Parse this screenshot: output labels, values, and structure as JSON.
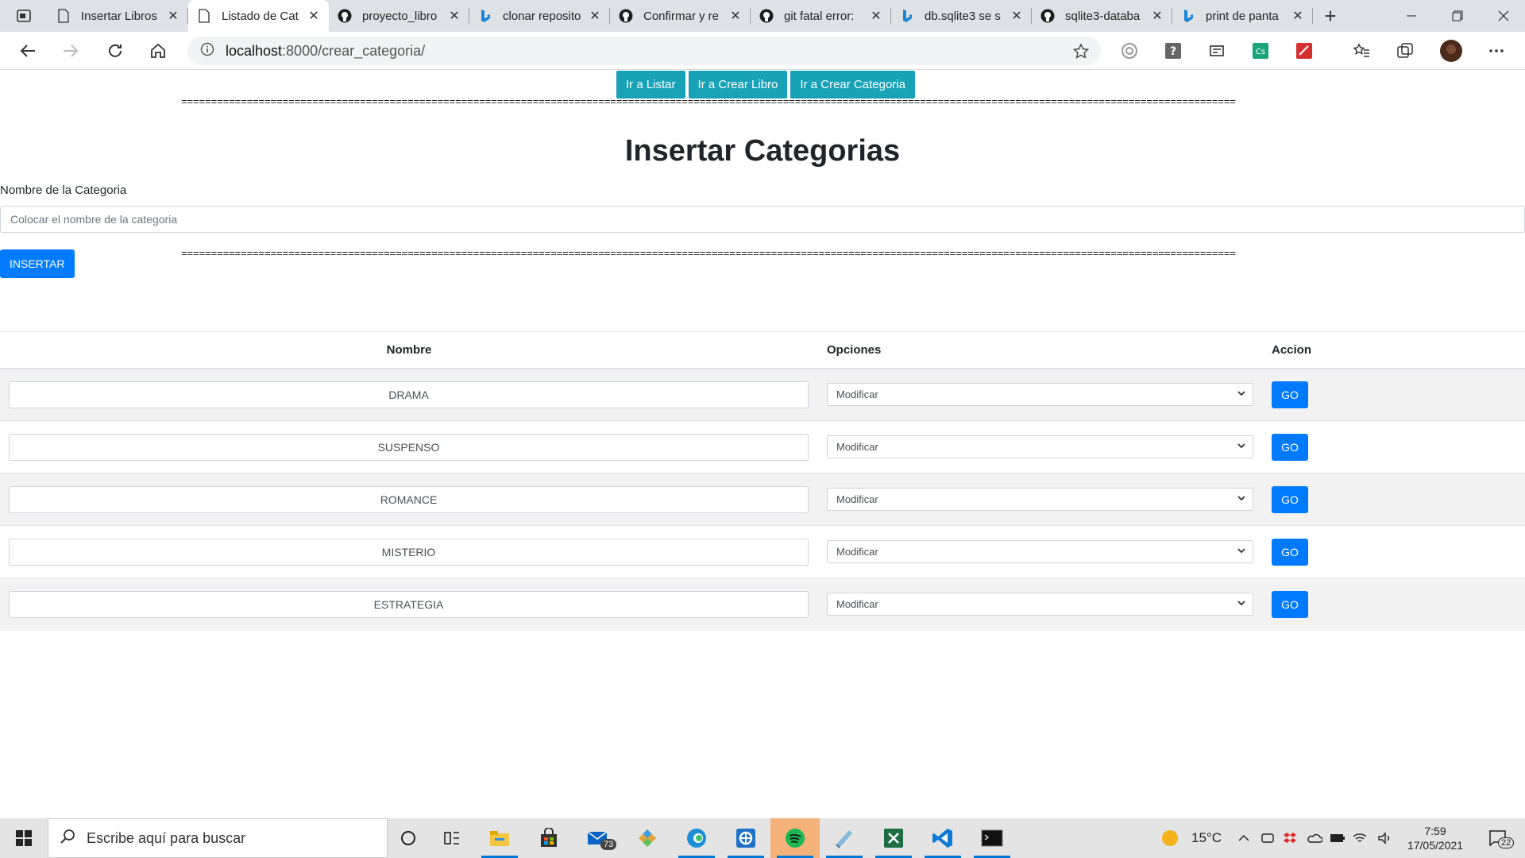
{
  "browser": {
    "tabs": [
      {
        "label": "Insertar Libros",
        "icon": "page-icon",
        "active": false
      },
      {
        "label": "Listado de Cat",
        "icon": "page-icon",
        "active": true
      },
      {
        "label": "proyecto_libro",
        "icon": "github-icon",
        "active": false
      },
      {
        "label": "clonar reposito",
        "icon": "bing-icon",
        "active": false
      },
      {
        "label": "Confirmar y re",
        "icon": "github-icon",
        "active": false
      },
      {
        "label": "git fatal error:",
        "icon": "github-icon",
        "active": false
      },
      {
        "label": "db.sqlite3 se s",
        "icon": "bing-icon",
        "active": false
      },
      {
        "label": "sqlite3-databa",
        "icon": "github-icon",
        "active": false
      },
      {
        "label": "print de panta",
        "icon": "bing-icon",
        "active": false
      }
    ],
    "url_host": "localhost",
    "url_path": ":8000/crear_categoria/"
  },
  "nav": {
    "listar": "Ir a Listar",
    "crear_libro": "Ir a Crear Libro",
    "crear_categoria": "Ir a Crear Categoria"
  },
  "separator": "=================================================================================================================================================================================",
  "form": {
    "title": "Insertar Categorias",
    "label": "Nombre de la Categoria",
    "placeholder": "Colocar el nombre de la categoria",
    "submit": "INSERTAR"
  },
  "table": {
    "headers": [
      "Nombre",
      "Opciones",
      "Accion"
    ],
    "rows": [
      {
        "name": "DRAMA",
        "option": "Modificar",
        "action": "GO"
      },
      {
        "name": "SUSPENSO",
        "option": "Modificar",
        "action": "GO"
      },
      {
        "name": "ROMANCE",
        "option": "Modificar",
        "action": "GO"
      },
      {
        "name": "MISTERIO",
        "option": "Modificar",
        "action": "GO"
      },
      {
        "name": "ESTRATEGIA",
        "option": "Modificar",
        "action": "GO"
      }
    ]
  },
  "taskbar": {
    "search_placeholder": "Escribe aquí para buscar",
    "mail_badge": "73",
    "weather": "15°C",
    "time": "7:59",
    "date": "17/05/2021",
    "notifications": "22"
  },
  "colors": {
    "nav_button": "#17a2b8",
    "primary": "#007bff"
  }
}
